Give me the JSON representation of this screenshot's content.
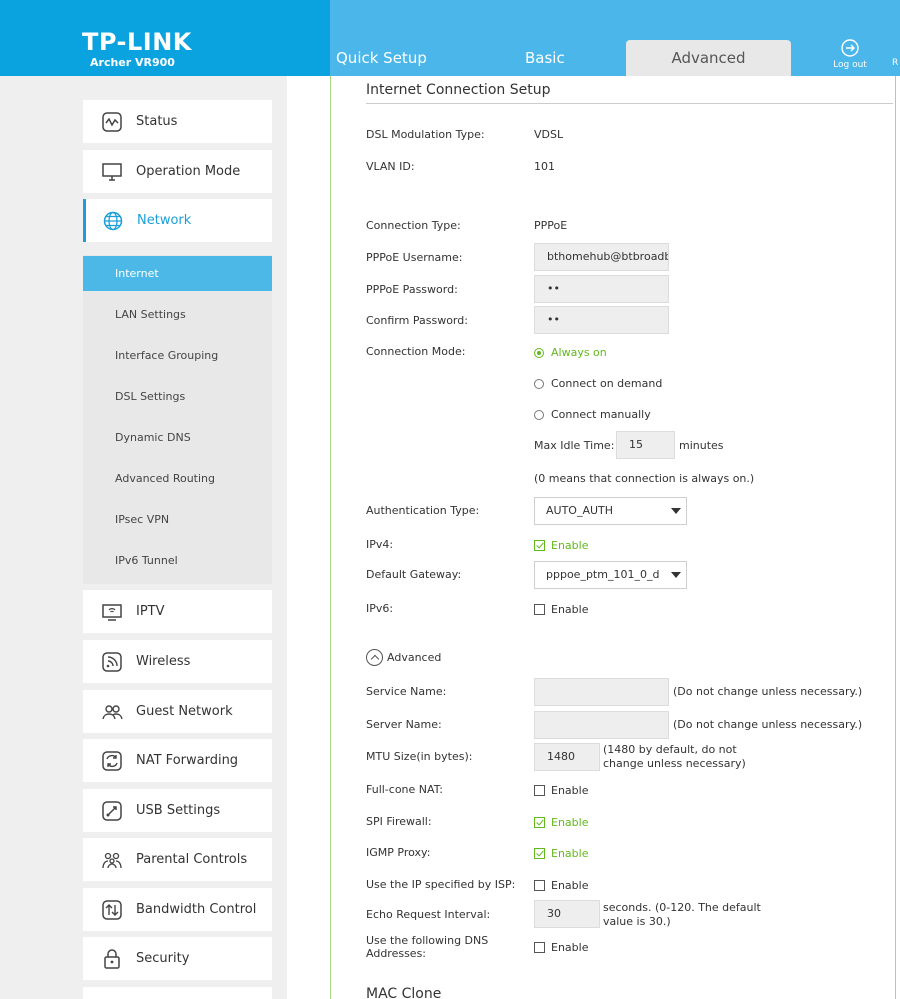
{
  "header": {
    "logo": "TP-LINK",
    "model": "Archer VR900",
    "tabs": [
      "Quick Setup",
      "Basic",
      "Advanced"
    ],
    "logout_label": "Log out",
    "edge_label": "R"
  },
  "sidebar": {
    "items": [
      {
        "label": "Status",
        "icon": "status-icon"
      },
      {
        "label": "Operation Mode",
        "icon": "monitor-icon"
      },
      {
        "label": "Network",
        "icon": "globe-icon"
      },
      {
        "label": "IPTV",
        "icon": "tv-icon"
      },
      {
        "label": "Wireless",
        "icon": "wireless-icon"
      },
      {
        "label": "Guest Network",
        "icon": "guest-icon"
      },
      {
        "label": "NAT Forwarding",
        "icon": "nat-icon"
      },
      {
        "label": "USB Settings",
        "icon": "usb-icon"
      },
      {
        "label": "Parental Controls",
        "icon": "parental-icon"
      },
      {
        "label": "Bandwidth Control",
        "icon": "bandwidth-icon"
      },
      {
        "label": "Security",
        "icon": "lock-icon"
      }
    ],
    "subitems": [
      "Internet",
      "LAN Settings",
      "Interface Grouping",
      "DSL Settings",
      "Dynamic DNS",
      "Advanced Routing",
      "IPsec VPN",
      "IPv6 Tunnel"
    ]
  },
  "main": {
    "title": "Internet Connection Setup",
    "dsl_label": "DSL Modulation Type:",
    "dsl_value": "VDSL",
    "vlan_label": "VLAN ID:",
    "vlan_value": "101",
    "conn_type_label": "Connection Type:",
    "conn_type_value": "PPPoE",
    "username_label": "PPPoE Username:",
    "username_value": "bthomehub@btbroadband.com",
    "password_label": "PPPoE Password:",
    "password_value": "••",
    "confirm_label": "Confirm Password:",
    "confirm_value": "••",
    "mode_label": "Connection Mode:",
    "mode_options": [
      "Always on",
      "Connect on demand",
      "Connect manually"
    ],
    "idle_label": "Max Idle Time:",
    "idle_value": "15",
    "idle_unit": "minutes",
    "idle_note": "(0 means that connection is always on.)",
    "auth_label": "Authentication Type:",
    "auth_value": "AUTO_AUTH",
    "ipv4_label": "IPv4:",
    "enable": "Enable",
    "gateway_label": "Default Gateway:",
    "gateway_value": "pppoe_ptm_101_0_d",
    "ipv6_label": "IPv6:",
    "advanced_label": "Advanced",
    "service_label": "Service Name:",
    "server_label": "Server Name:",
    "no_change_note": "(Do not change unless necessary.)",
    "mtu_label": "MTU Size(in bytes):",
    "mtu_value": "1480",
    "mtu_note_1": "(1480 by default, do not",
    "mtu_note_2": "change unless necessary)",
    "fullcone_label": "Full-cone NAT:",
    "spi_label": "SPI Firewall:",
    "igmp_label": "IGMP Proxy:",
    "isp_ip_label": "Use the IP specified by ISP:",
    "echo_label": "Echo Request Interval:",
    "echo_value": "30",
    "echo_note_1": "seconds. (0-120. The default",
    "echo_note_2": "value is 30.)",
    "dns_label_1": "Use the following DNS",
    "dns_label_2": "Addresses:",
    "mac_title": "MAC Clone"
  }
}
